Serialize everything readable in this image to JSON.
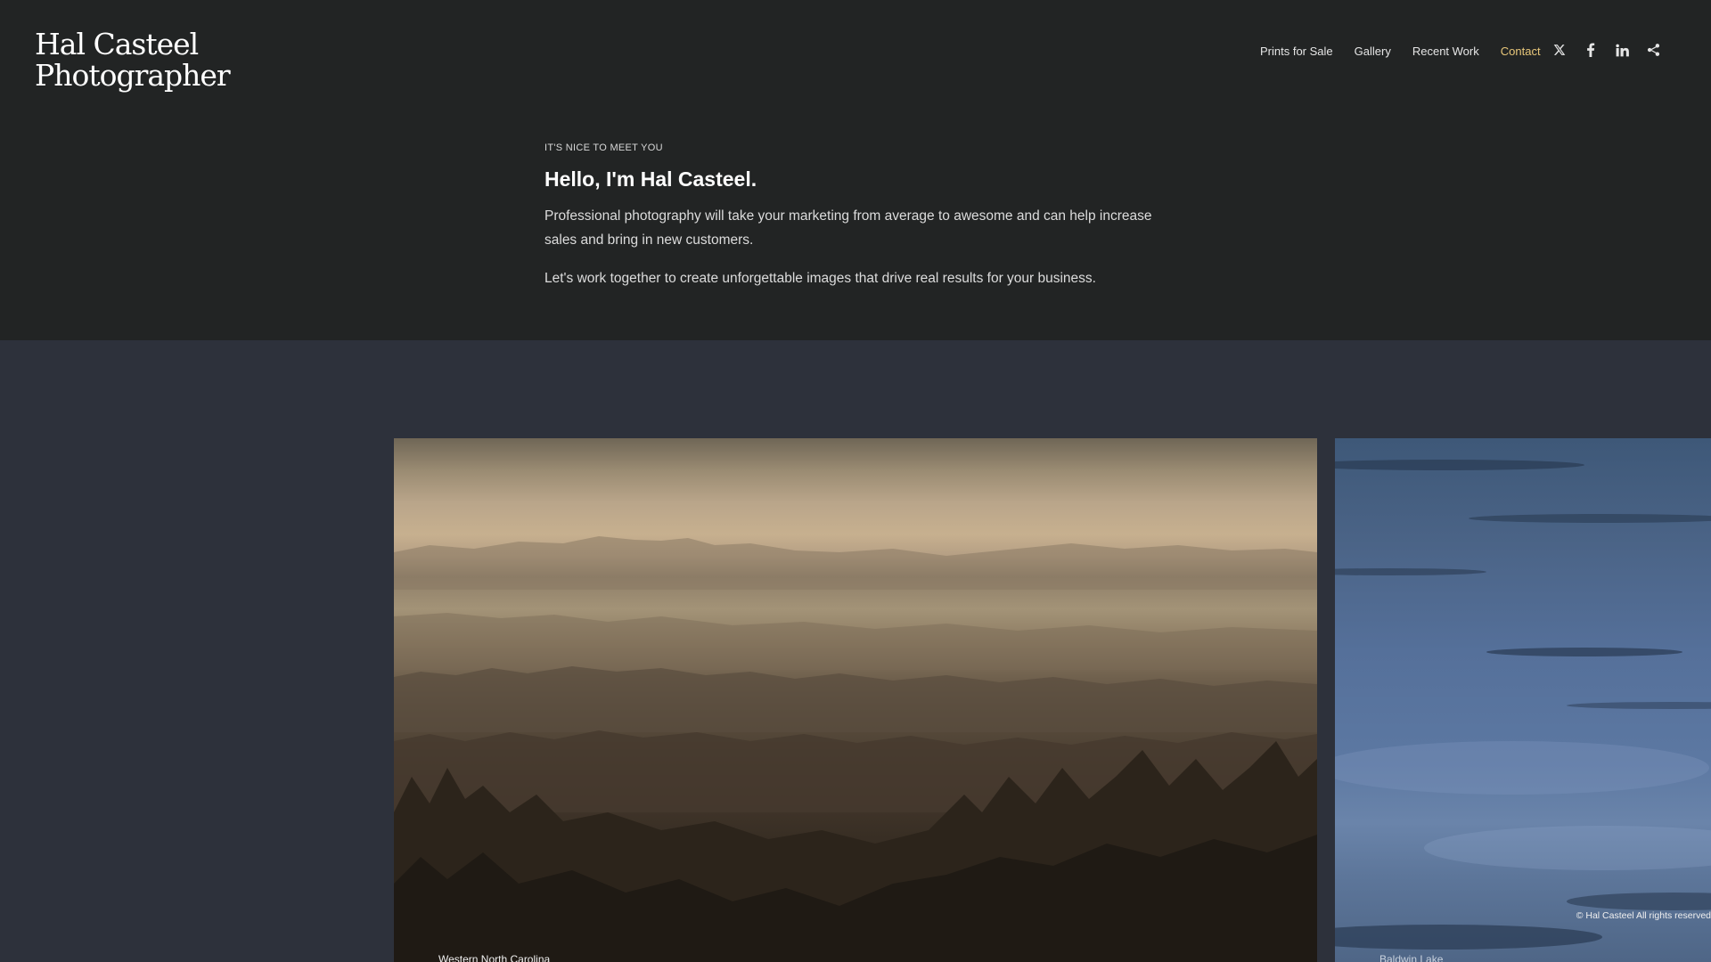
{
  "site": {
    "logo_line1": "Hal Casteel",
    "logo_line2": "Photographer"
  },
  "nav": {
    "items": [
      {
        "label": "Prints for Sale"
      },
      {
        "label": "Gallery"
      },
      {
        "label": "Recent Work"
      },
      {
        "label": "Contact"
      }
    ],
    "active": "Contact",
    "active_color": "#e8c77a"
  },
  "social": {
    "icons": [
      "x-icon",
      "facebook-icon",
      "linkedin-icon",
      "share-icon"
    ]
  },
  "intro": {
    "eyebrow": "IT'S NICE TO MEET YOU",
    "headline": "Hello, I'm Hal Casteel.",
    "paragraph1": "Professional photography will take your marketing from average to awesome and can help increase sales and bring in new customers.",
    "paragraph2": "Let's work together to create unforgettable images that drive real results for your business."
  },
  "gallery": {
    "photos": [
      {
        "caption": "Western North Carolina"
      },
      {
        "caption": "Baldwin Lake",
        "copyright": "© Hal Casteel All rights reserved"
      }
    ]
  },
  "colors": {
    "header_bg": "#222424",
    "gallery_bg": "#2d313b"
  }
}
